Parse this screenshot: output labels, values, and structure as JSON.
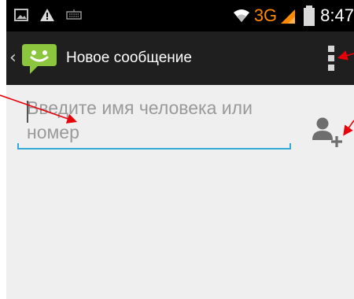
{
  "status_bar": {
    "network_type": "3G",
    "time": "8:47",
    "network_color": "#ff8a00"
  },
  "action_bar": {
    "title": "Новое сообщение"
  },
  "recipient": {
    "placeholder": "Введите имя человека или номер"
  },
  "icons": {
    "app": "messaging-smiley-icon",
    "add_contact": "add-contact-icon",
    "overflow": "overflow-menu-icon"
  },
  "colors": {
    "accent": "#33a9d6",
    "annotation_arrow": "#e8000b",
    "app_icon": "#8cc63f"
  }
}
